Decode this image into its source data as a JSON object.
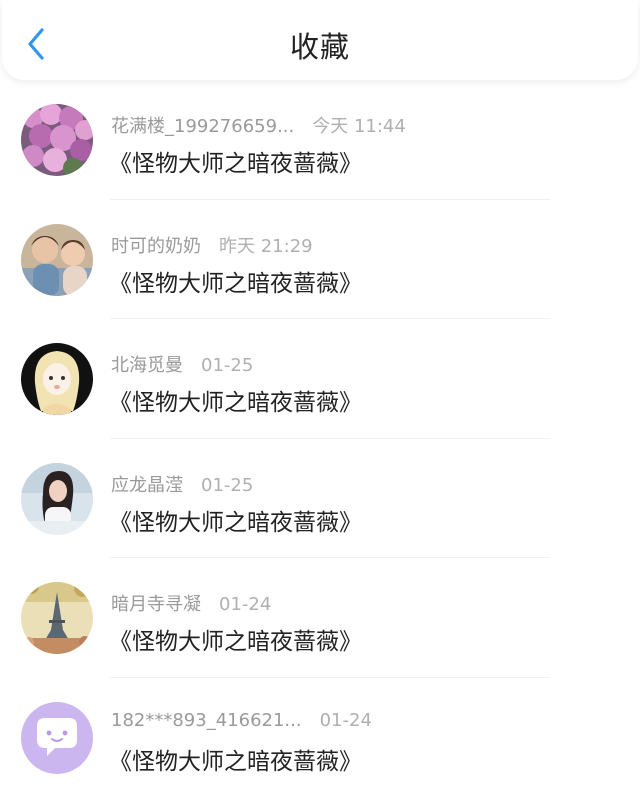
{
  "header": {
    "title": "收藏",
    "back_icon": "chevron-left-icon",
    "accent": "#2f95f0"
  },
  "items": [
    {
      "user": "花满楼_199276659...",
      "time": "今天 11:44",
      "book": "《怪物大师之暗夜蔷薇》",
      "avatar": "flowers-avatar"
    },
    {
      "user": "时可的奶奶",
      "time": "昨天 21:29",
      "book": "《怪物大师之暗夜蔷薇》",
      "avatar": "children-photo-avatar"
    },
    {
      "user": "北海觅曼",
      "time": "01-25",
      "book": "《怪物大师之暗夜蔷薇》",
      "avatar": "cartoon-girl-avatar"
    },
    {
      "user": "应龙晶滢",
      "time": "01-25",
      "book": "《怪物大师之暗夜蔷薇》",
      "avatar": "woman-photo-avatar"
    },
    {
      "user": "暗月寺寻凝",
      "time": "01-24",
      "book": "《怪物大师之暗夜蔷薇》",
      "avatar": "eiffel-tower-avatar"
    },
    {
      "user": "182***893_416621...",
      "time": "01-24",
      "book": "《怪物大师之暗夜蔷薇》",
      "avatar": "chat-bubble-avatar"
    }
  ]
}
